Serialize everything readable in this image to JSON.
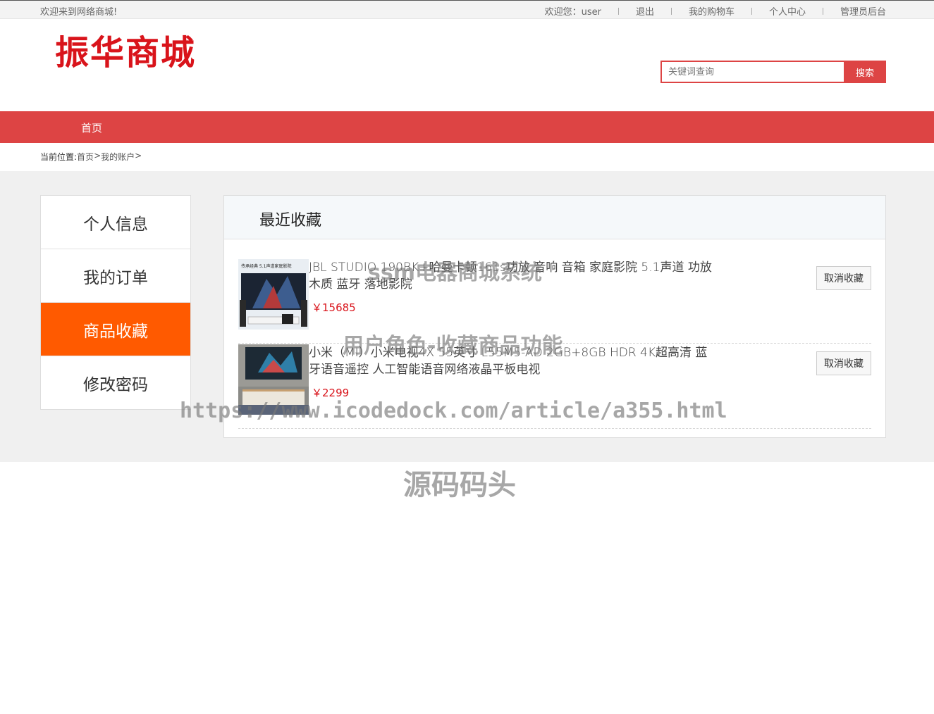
{
  "topbar": {
    "welcome": "欢迎来到网络商城!",
    "user_greeting": "欢迎您：user",
    "logout": "退出",
    "cart": "我的购物车",
    "profile": "个人中心",
    "admin": "管理员后台"
  },
  "header": {
    "logo": "振华商城",
    "search_placeholder": "关键词查询",
    "search_button": "搜索"
  },
  "nav": {
    "home": "首页"
  },
  "breadcrumb": {
    "label": "当前位置:",
    "home": "首页",
    "sep": ">",
    "account": "我的账户",
    "trail": ">"
  },
  "sidebar": {
    "items": [
      {
        "label": "个人信息"
      },
      {
        "label": "我的订单"
      },
      {
        "label": "商品收藏"
      },
      {
        "label": "修改密码"
      }
    ],
    "active_index": 2
  },
  "favorites": {
    "title": "最近收藏",
    "items": [
      {
        "name": "JBL STUDIO 190BK+哈曼卡顿161s功放 音响 音箱 家庭影院 5.1声道 功放 木质 蓝牙 落地影院",
        "price": "￥15685",
        "image_caption": "传承经典 5.1声道家庭影院",
        "remove_label": "取消收藏"
      },
      {
        "name": "小米（MI）小米电视4X 55英寸 L55M5-AD 2GB+8GB HDR 4K超高清 蓝牙语音遥控 人工智能语音网络液晶平板电视",
        "price": "￥2299",
        "remove_label": "取消收藏"
      }
    ]
  },
  "watermark": {
    "line1": "ssm电器商城系统",
    "line2": "用户角色-收藏商品功能",
    "line3": "https://www.icodedock.com/article/a355.html",
    "line4": "源码码头"
  },
  "colors": {
    "brand_red": "#dd4444",
    "active_orange": "#ff5a00",
    "price_red": "#d9141b"
  }
}
